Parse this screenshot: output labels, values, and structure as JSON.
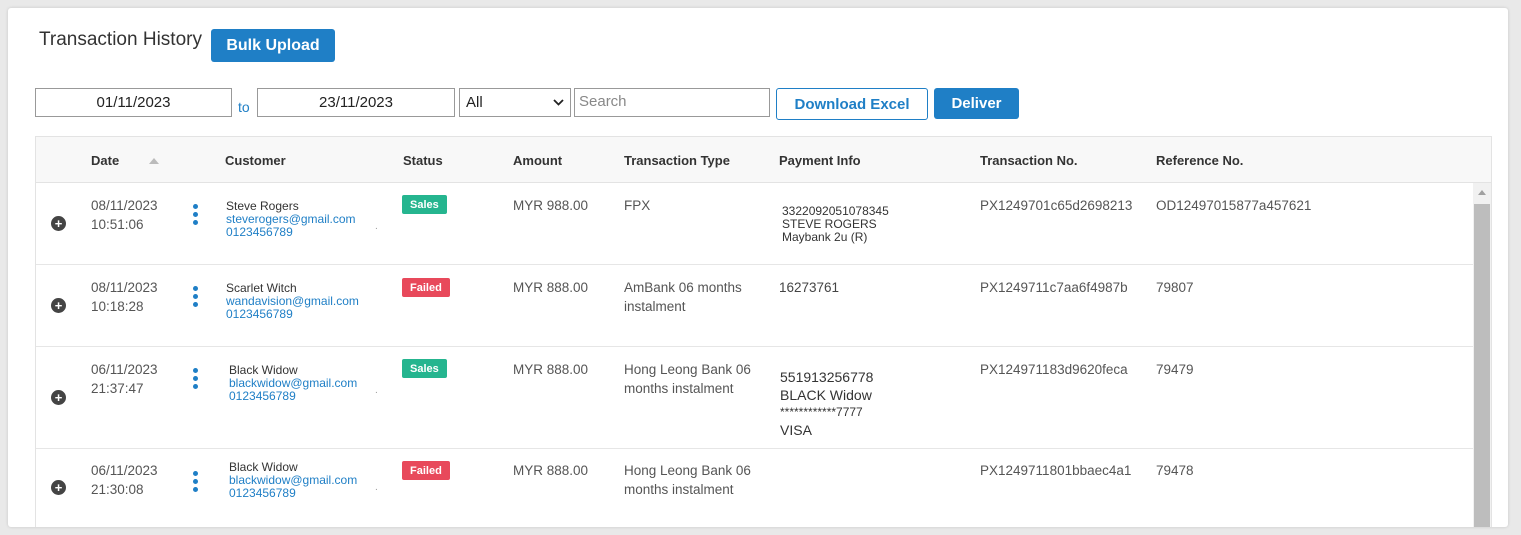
{
  "header": {
    "title": "Transaction History",
    "bulk_upload_label": "Bulk Upload"
  },
  "filters": {
    "date_from": "01/11/2023",
    "to_label": "to",
    "date_to": "23/11/2023",
    "status_selected": "All",
    "search_placeholder": "Search",
    "download_excel_label": "Download Excel",
    "deliver_label": "Deliver"
  },
  "table": {
    "columns": [
      "Date",
      "Customer",
      "Status",
      "Amount",
      "Transaction Type",
      "Payment Info",
      "Transaction No.",
      "Reference No."
    ],
    "rows": [
      {
        "date": "08/11/2023",
        "time": "10:51:06",
        "customer_name": "Steve Rogers",
        "customer_email": "steverogers@gmail.com",
        "customer_phone": "0123456789",
        "status": "Sales",
        "amount": "MYR 988.00",
        "type_line1": "FPX",
        "type_line2": "",
        "payment_line1": "3322092051078345",
        "payment_line2": "STEVE ROGERS",
        "payment_line3": "Maybank 2u (R)",
        "txn_no": "PX1249701c65d2698213",
        "ref_no": "OD12497015877a457621"
      },
      {
        "date": "08/11/2023",
        "time": "10:18:28",
        "customer_name": "Scarlet Witch",
        "customer_email": "wandavision@gmail.com",
        "customer_phone": "0123456789",
        "status": "Failed",
        "amount": "MYR 888.00",
        "type_line1": "AmBank 06 months",
        "type_line2": "instalment",
        "payment_line1": "16273761",
        "txn_no": "PX1249711c7aa6f4987b",
        "ref_no": "79807"
      },
      {
        "date": "06/11/2023",
        "time": "21:37:47",
        "customer_name": "Black Widow",
        "customer_email": "blackwidow@gmail.com",
        "customer_phone": "0123456789",
        "status": "Sales",
        "amount": "MYR 888.00",
        "type_line1": "Hong Leong Bank 06",
        "type_line2": "months instalment",
        "payment_line1": "551913256778",
        "payment_line2": "BLACK Widow",
        "payment_line3": "************7777",
        "payment_line4": "VISA",
        "txn_no": "PX124971183d9620feca",
        "ref_no": "79479"
      },
      {
        "date": "06/11/2023",
        "time": "21:30:08",
        "customer_name": "Black Widow",
        "customer_email": "blackwidow@gmail.com",
        "customer_phone": "0123456789",
        "status": "Failed",
        "amount": "MYR 888.00",
        "type_line1": "Hong Leong Bank 06",
        "type_line2": "months instalment",
        "txn_no": "PX1249711801bbaec4a1",
        "ref_no": "79478"
      }
    ]
  },
  "colors": {
    "primary": "#1f7fc6",
    "sales": "#25b58f",
    "failed": "#e8495b"
  },
  "icons": {
    "expand": "plus-circle-icon",
    "actions": "vertical-dots-icon",
    "sort": "sort-asc-icon"
  }
}
